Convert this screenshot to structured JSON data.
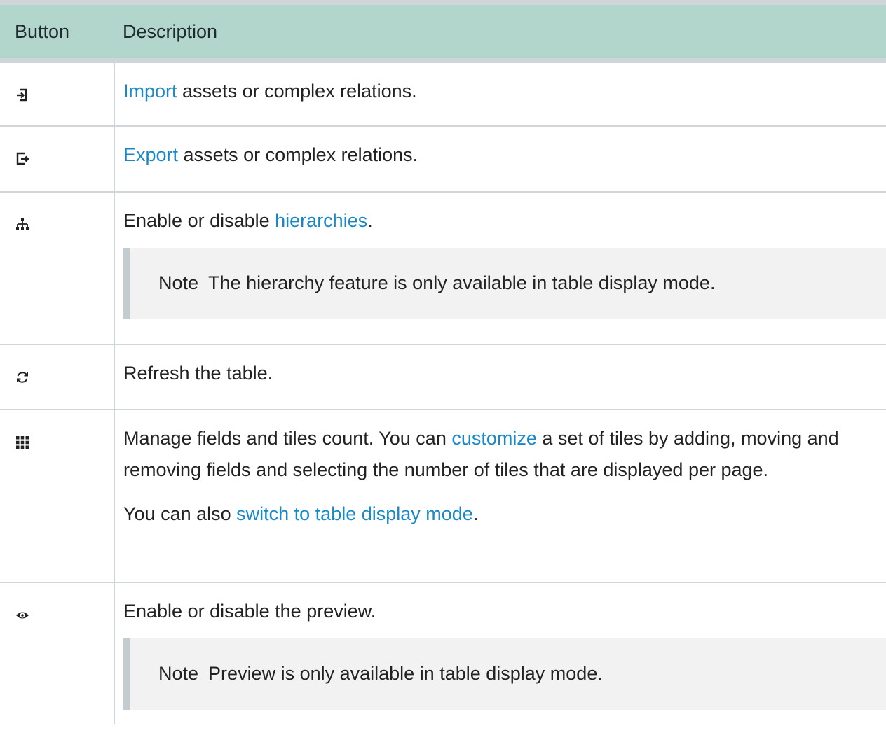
{
  "header": {
    "col_button": "Button",
    "col_description": "Description"
  },
  "rows": [
    {
      "icon": "import-icon",
      "link": "Import",
      "text": " assets or complex relations."
    },
    {
      "icon": "export-icon",
      "link": "Export",
      "text": " assets or complex relations."
    },
    {
      "icon": "hierarchy-icon",
      "pre": "Enable or disable ",
      "link": "hierarchies",
      "post": ".",
      "note_label": "Note",
      "note_text": "The hierarchy feature is only available in table display mode."
    },
    {
      "icon": "refresh-icon",
      "text": "Refresh the table."
    },
    {
      "icon": "grid-icon",
      "pre": "Manage fields and tiles count. You can ",
      "link": "customize",
      "post": " a set of tiles by adding, moving and removing fields and selecting the number of tiles that are displayed per page.",
      "p2_pre": "You can also ",
      "p2_link": "switch to table display mode",
      "p2_post": "."
    },
    {
      "icon": "eye-icon",
      "text": "Enable or disable the preview.",
      "note_label": "Note",
      "note_text": "Preview is only available in table display mode."
    }
  ],
  "colors": {
    "header_bg": "#b3d6cc",
    "link": "#1a87c7",
    "border": "#cfd5d8",
    "note_bg": "#f2f2f2",
    "note_bar": "#c4ccd0"
  }
}
